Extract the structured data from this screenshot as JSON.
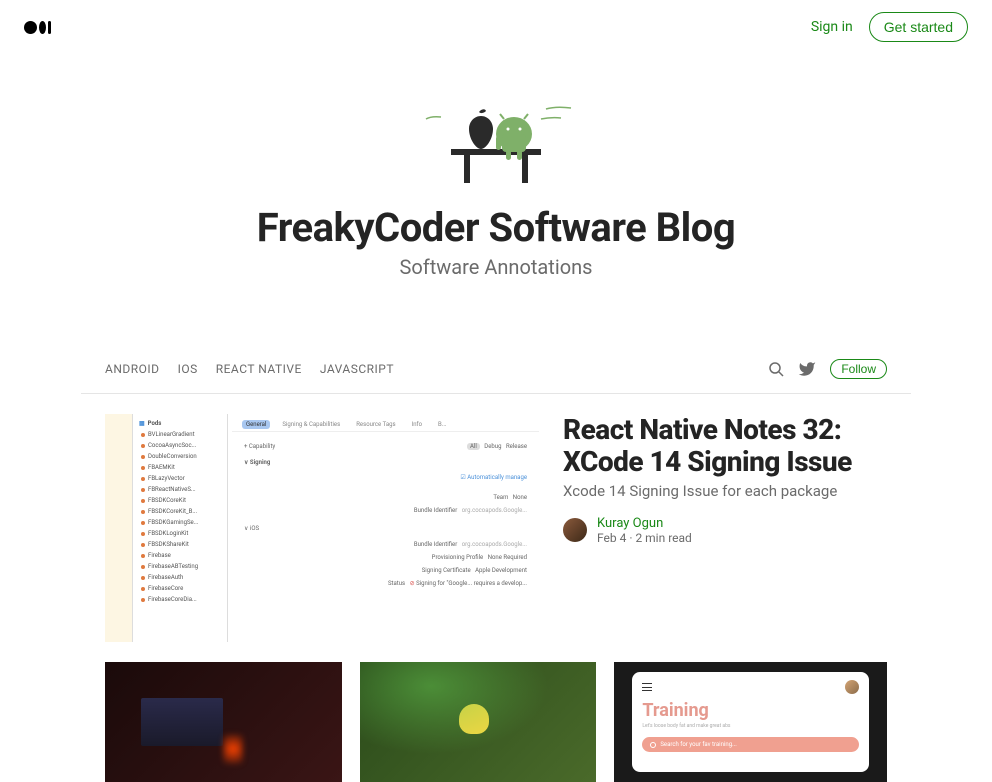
{
  "header": {
    "signin": "Sign in",
    "get_started": "Get started"
  },
  "hero": {
    "title": "FreakyCoder Software Blog",
    "subtitle": "Software Annotations"
  },
  "nav": {
    "items": [
      "ANDROID",
      "IOS",
      "REACT NATIVE",
      "JAVASCRIPT"
    ],
    "follow": "Follow"
  },
  "featured": {
    "title": "React Native Notes 32: XCode 14 Signing Issue",
    "subtitle": "Xcode 14 Signing Issue for each package",
    "author": "Kuray Ogun",
    "date": "Feb 4",
    "read_time": "2 min read",
    "xcode": {
      "pods": "Pods",
      "sidebar_items": [
        "BVLinearGradient",
        "CocoaAsyncSoc...",
        "DoubleConversion",
        "FBAEMKit",
        "FBLazyVector",
        "FBReactNativeS...",
        "FBSDKCoreKit",
        "FBSDKCoreKit_B...",
        "FBSDKGamingSe...",
        "FBSDKLoginKit",
        "FBSDKShareKit",
        "Firebase",
        "FirebaseABTesting",
        "FirebaseAuth",
        "FirebaseCore",
        "FirebaseCoreDia..."
      ],
      "tabs": [
        "General",
        "Signing & Capabilities",
        "Resource Tags",
        "Info",
        "B..."
      ],
      "capability": "+ Capability",
      "modes": [
        "All",
        "Debug",
        "Release"
      ],
      "signing": "Signing",
      "auto_manage": "Automatically manage",
      "team_label": "Team",
      "team_value": "None",
      "bundle_label": "Bundle Identifier",
      "bundle_value": "org.cocoapods.Google...",
      "ios": "iOS",
      "profile_label": "Provisioning Profile",
      "profile_value": "None Required",
      "cert_label": "Signing Certificate",
      "cert_value": "Apple Development",
      "status_label": "Status",
      "status_value": "Signing for \"Google... requires a develop..."
    }
  },
  "cards": {
    "training_title": "Training",
    "training_sub": "Let's loose body fat and make great abs",
    "search_placeholder": "Search for your fav training..."
  }
}
